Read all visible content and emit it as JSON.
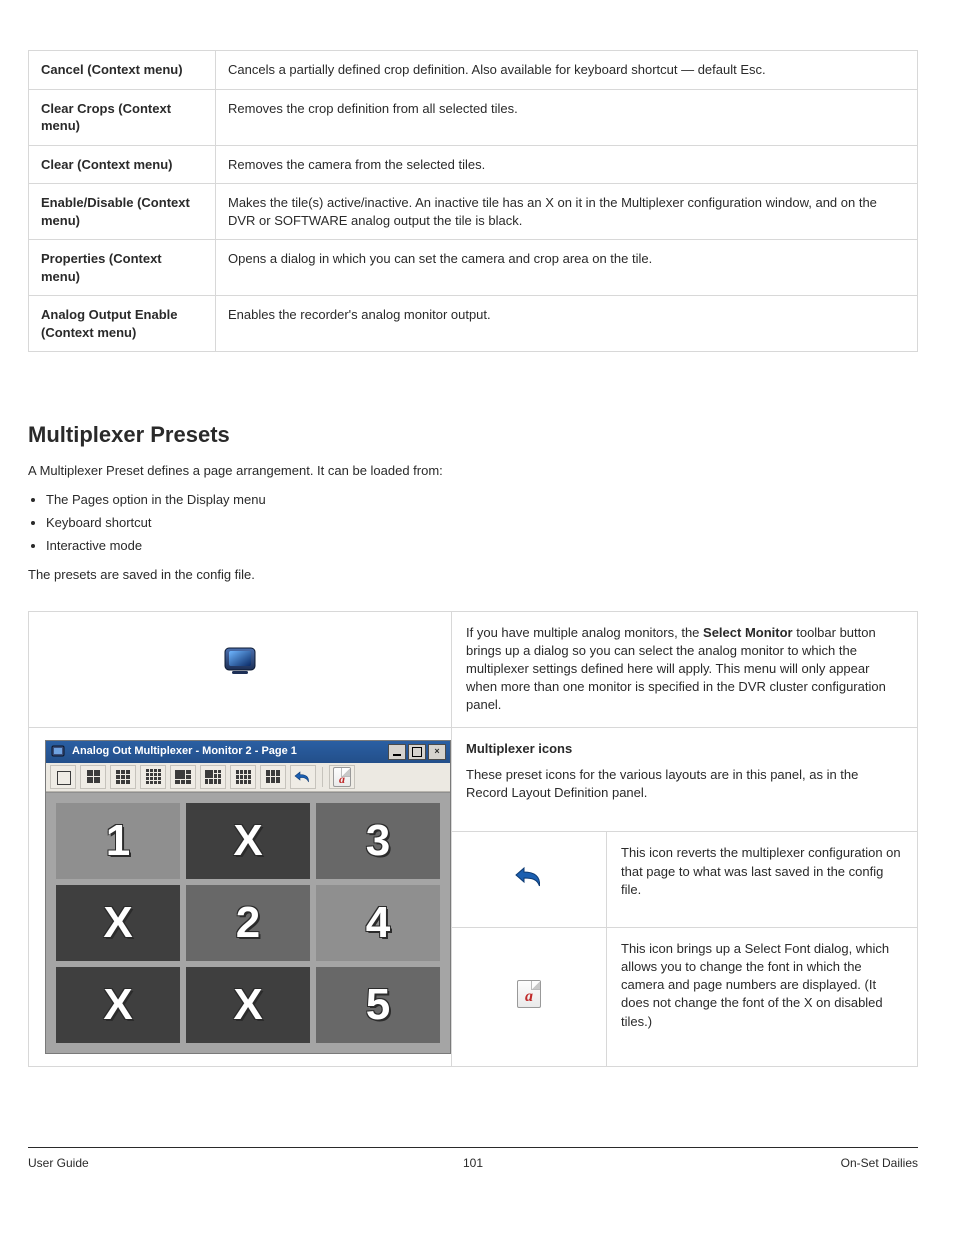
{
  "upper_rows": [
    {
      "label": "Cancel (Context menu)",
      "desc": "Cancels a partially defined crop definition. Also available for keyboard shortcut — default Esc."
    },
    {
      "label": "Clear Crops (Context menu)",
      "desc": "Removes the crop definition from all selected tiles."
    },
    {
      "label": "Clear (Context menu)",
      "desc": "Removes the camera from the selected tiles."
    },
    {
      "label": "Enable/Disable (Context menu)",
      "desc": "Makes the tile(s) active/inactive. An inactive tile has an X on it in the Multiplexer configuration window, and on the DVR or SOFTWARE analog output the tile is black."
    },
    {
      "label": "Properties (Context menu)",
      "desc": "Opens a dialog in which you can set the camera and crop area on the tile."
    },
    {
      "label": "Analog Output Enable (Context menu)",
      "desc": "Enables the recorder's analog monitor output."
    }
  ],
  "section": {
    "title": "Multiplexer Presets",
    "para1": "A Multiplexer Preset defines a page arrangement. It can be loaded from:",
    "bullets": [
      "The Pages option in the Display menu",
      "Keyboard shortcut",
      "Interactive mode"
    ],
    "para2": "The presets are saved in the config file."
  },
  "lower": {
    "head_desc_prefix": "If you have multiple analog monitors, the ",
    "head_desc_bold": "Select Monitor",
    "head_desc_suffix": " toolbar button brings up a dialog so you can select the analog monitor to which the multiplexer settings defined here will apply. This menu will only appear when more than one monitor is specified in the DVR cluster configuration panel.",
    "panel1_title": "Multiplexer icons",
    "panel1_body": "These preset icons for the various layouts are in this panel, as in the Record Layout Definition panel.",
    "panel2_body": "This icon reverts the multiplexer configuration on that page to what was last saved in the config file.",
    "panel3_body": "This icon brings up a Select Font dialog, which allows you to change the font in which the camera and page numbers are displayed. (It does not change the font of the X on disabled tiles.)",
    "win_title": "Analog Out Multiplexer - Monitor 2 - Page 1",
    "tiles": [
      {
        "v": "1",
        "cls": "light"
      },
      {
        "v": "X",
        "cls": "dark"
      },
      {
        "v": "3",
        "cls": "mid"
      },
      {
        "v": "X",
        "cls": "dark"
      },
      {
        "v": "2",
        "cls": "mid"
      },
      {
        "v": "4",
        "cls": "light"
      },
      {
        "v": "X",
        "cls": "dark"
      },
      {
        "v": "X",
        "cls": "dark"
      },
      {
        "v": "5",
        "cls": "mid"
      }
    ]
  },
  "footer": {
    "left": "User Guide",
    "center": "101",
    "right": "On-Set Dailies"
  }
}
